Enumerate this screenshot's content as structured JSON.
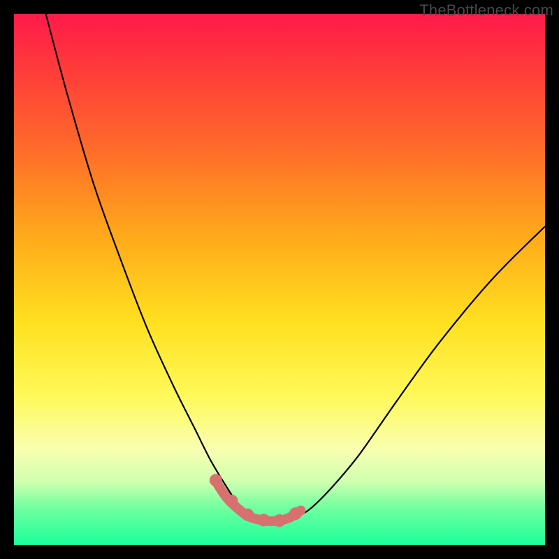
{
  "watermark": "TheBottleneck.com",
  "chart_data": {
    "type": "line",
    "title": "",
    "xlabel": "",
    "ylabel": "",
    "xlim": [
      0,
      100
    ],
    "ylim": [
      0,
      100
    ],
    "series": [
      {
        "name": "curve",
        "x": [
          6,
          10,
          15,
          20,
          25,
          30,
          34,
          37,
          40,
          42,
          44,
          46,
          48,
          50,
          53,
          56,
          60,
          65,
          72,
          80,
          90,
          100
        ],
        "y": [
          100,
          85,
          68,
          54,
          41,
          30,
          22,
          16,
          11,
          8,
          6,
          5,
          4.5,
          4.5,
          5.2,
          7,
          11,
          17,
          27,
          38,
          50,
          60
        ]
      }
    ],
    "highlight_segment": {
      "x": [
        38,
        40,
        42,
        44,
        46,
        48,
        50,
        52,
        54
      ],
      "y": [
        12,
        9,
        7,
        5.5,
        4.8,
        4.5,
        4.6,
        5.2,
        6.5
      ]
    },
    "highlight_dots": {
      "x": [
        38,
        41,
        44,
        47,
        50,
        53
      ],
      "y": [
        12.2,
        8.3,
        5.7,
        4.7,
        4.6,
        5.9
      ]
    },
    "colors": {
      "curve": "#000000",
      "highlight": "#d97070"
    }
  }
}
